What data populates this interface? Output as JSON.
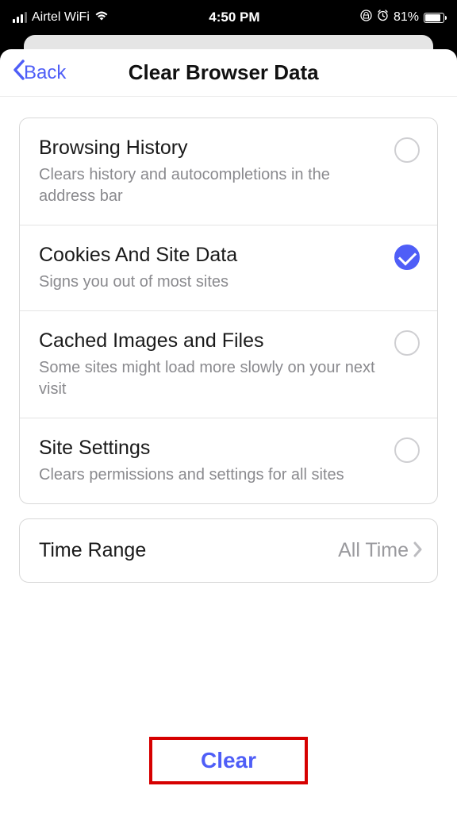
{
  "statusBar": {
    "carrier": "Airtel WiFi",
    "time": "4:50 PM",
    "batteryPct": "81%"
  },
  "nav": {
    "back": "Back",
    "title": "Clear Browser Data"
  },
  "options": [
    {
      "title": "Browsing History",
      "desc": "Clears history and autocompletions in the address bar",
      "checked": false
    },
    {
      "title": "Cookies And Site Data",
      "desc": "Signs you out of most sites",
      "checked": true
    },
    {
      "title": "Cached Images and Files",
      "desc": "Some sites might load more slowly on your next visit",
      "checked": false
    },
    {
      "title": "Site Settings",
      "desc": "Clears permissions and settings for all sites",
      "checked": false
    }
  ],
  "timeRange": {
    "label": "Time Range",
    "value": "All Time"
  },
  "clearButton": "Clear",
  "colors": {
    "accent": "#4f5ef7",
    "highlightBox": "#d60000"
  }
}
